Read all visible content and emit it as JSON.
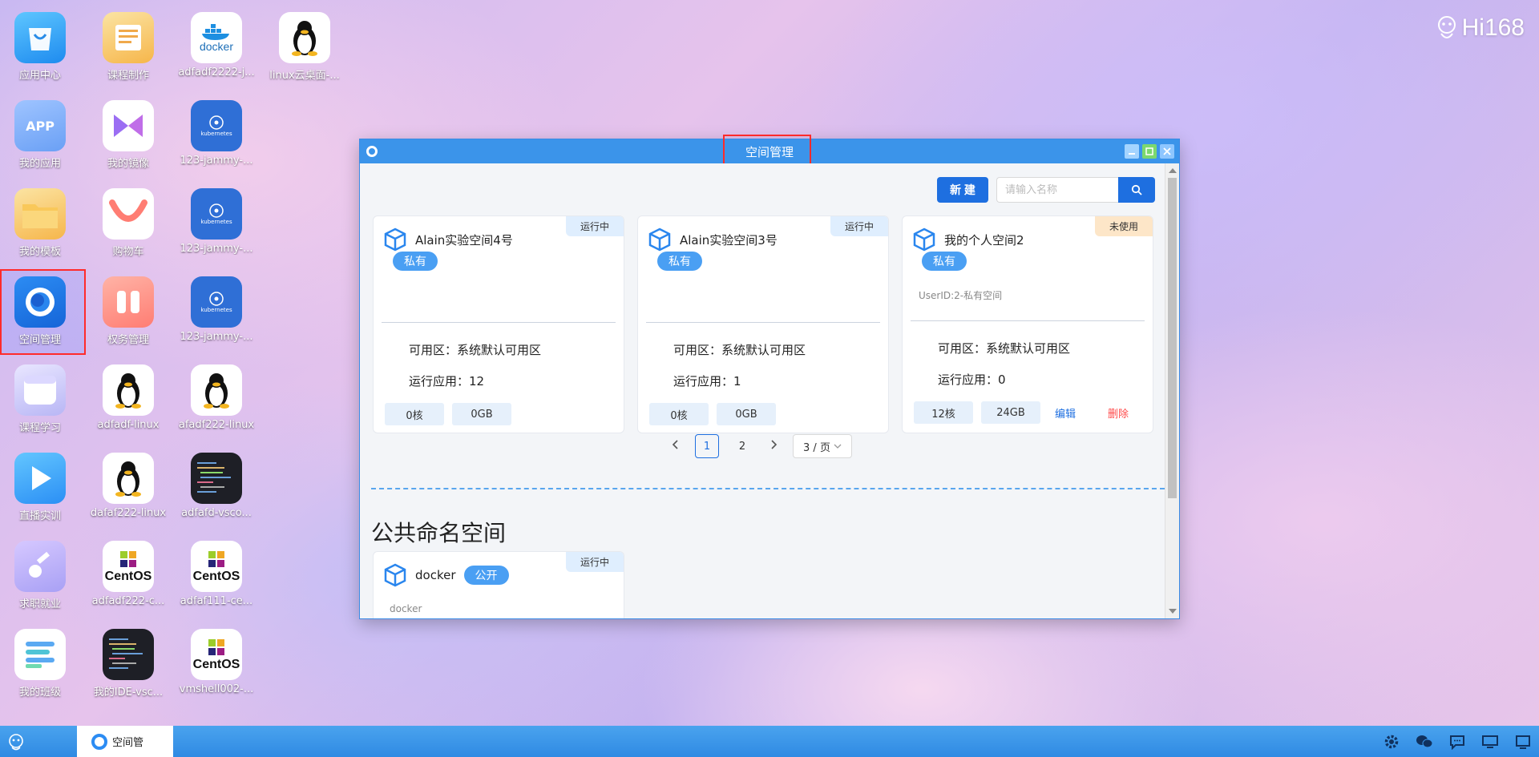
{
  "brand": {
    "name": "Hi168"
  },
  "desktop_icons": [
    {
      "label": "应用中心"
    },
    {
      "label": "课程制作"
    },
    {
      "label": "adfadf2222-j..."
    },
    {
      "label": "linux云桌面-..."
    },
    {
      "label": "我的应用",
      "text": "APP"
    },
    {
      "label": "我的镜像"
    },
    {
      "label": "123-jammy-...",
      "text": "kubernetes"
    },
    {
      "label": "我的模板"
    },
    {
      "label": "购物车"
    },
    {
      "label": "123-jammy-...",
      "text": "kubernetes"
    },
    {
      "label": "空间管理"
    },
    {
      "label": "权务管理"
    },
    {
      "label": "123-jammy-...",
      "text": "kubernetes"
    },
    {
      "label": "课程学习"
    },
    {
      "label": "adfadf-linux"
    },
    {
      "label": "afadf222-linux"
    },
    {
      "label": "直播实训"
    },
    {
      "label": "dafaf222-linux"
    },
    {
      "label": "adfafd-vsco..."
    },
    {
      "label": "求职就业"
    },
    {
      "label": "adfadf222-c..."
    },
    {
      "label": "adfaf111-ce..."
    },
    {
      "label": "我的班级"
    },
    {
      "label": "我的IDE-vsc..."
    },
    {
      "label": "vmshell002-..."
    }
  ],
  "docker_logo_text": "docker",
  "centos_logo_text": "CentOS",
  "window": {
    "title": "空间管理",
    "new_button": "新 建",
    "search_placeholder": "请输入名称",
    "cards": [
      {
        "name": "Alain实验空间4号",
        "status": "运行中",
        "tag": "私有",
        "sub": "",
        "zone": "可用区：系统默认可用区",
        "apps": "运行应用：12",
        "cpu": "0核",
        "mem": "0GB"
      },
      {
        "name": "Alain实验空间3号",
        "status": "运行中",
        "tag": "私有",
        "sub": "",
        "zone": "可用区：系统默认可用区",
        "apps": "运行应用：1",
        "cpu": "0核",
        "mem": "0GB"
      },
      {
        "name": "我的个人空间2",
        "status": "未使用",
        "tag": "私有",
        "sub": "UserID:2-私有空间",
        "zone": "可用区：系统默认可用区",
        "apps": "运行应用：0",
        "cpu": "12核",
        "mem": "24GB",
        "edit": "编辑",
        "delete": "删除"
      }
    ],
    "pager": {
      "prev": "<",
      "pages": [
        "1",
        "2"
      ],
      "next": ">",
      "page_size": "3 / 页",
      "current": "1"
    },
    "public_section_title": "公共命名空间",
    "public_cards": [
      {
        "name": "docker",
        "tag": "公开",
        "status": "运行中",
        "sub": "docker"
      }
    ]
  },
  "taskbar": {
    "app_label": "空间管"
  },
  "colors": {
    "accent": "#1e6fe0",
    "titlebar": "#3b94ea",
    "highlight_box": "#ff2b2b",
    "running_bg": "#dfeefe",
    "idle_bg": "#fde6c8",
    "delete": "#ff4a4a"
  }
}
